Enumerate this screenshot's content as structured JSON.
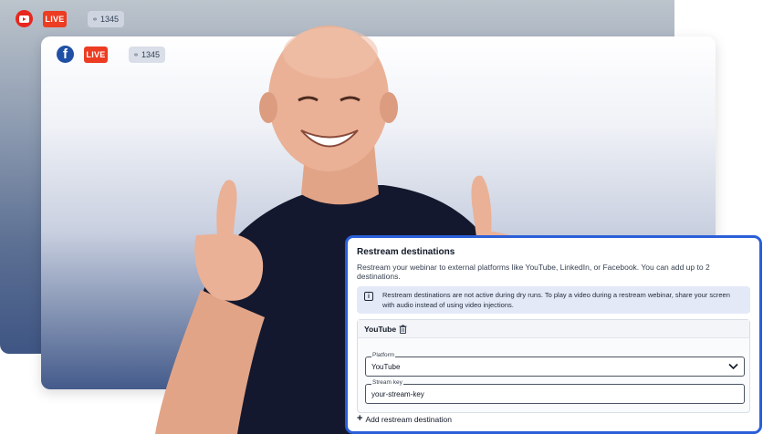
{
  "back_stream": {
    "platform_icon": "youtube-icon",
    "live_label": "LIVE",
    "views": "1345"
  },
  "front_stream": {
    "platform_icon": "facebook-icon",
    "platform_glyph": "f",
    "live_label": "LIVE",
    "views": "1345"
  },
  "colors": {
    "live_red": "#ec3c22",
    "youtube_red": "#e7261e",
    "facebook_blue": "#2050a6",
    "panel_border": "#2b5fd9",
    "info_bg": "#e4e9f8"
  },
  "panel": {
    "title": "Restream destinations",
    "description": "Restream your webinar to external platforms like YouTube, LinkedIn, or Facebook. You can add up to 2 destinations.",
    "info_text": "Restream destinations are not active during dry runs. To play a video during a restream webinar, share your screen with audio instead of using video injections.",
    "destination": {
      "name": "YouTube",
      "platform_label": "Platform",
      "platform_value": "YouTube",
      "stream_key_label": "Stream key",
      "stream_key_value": "your-stream-key"
    },
    "add_label": "Add restream destination"
  }
}
